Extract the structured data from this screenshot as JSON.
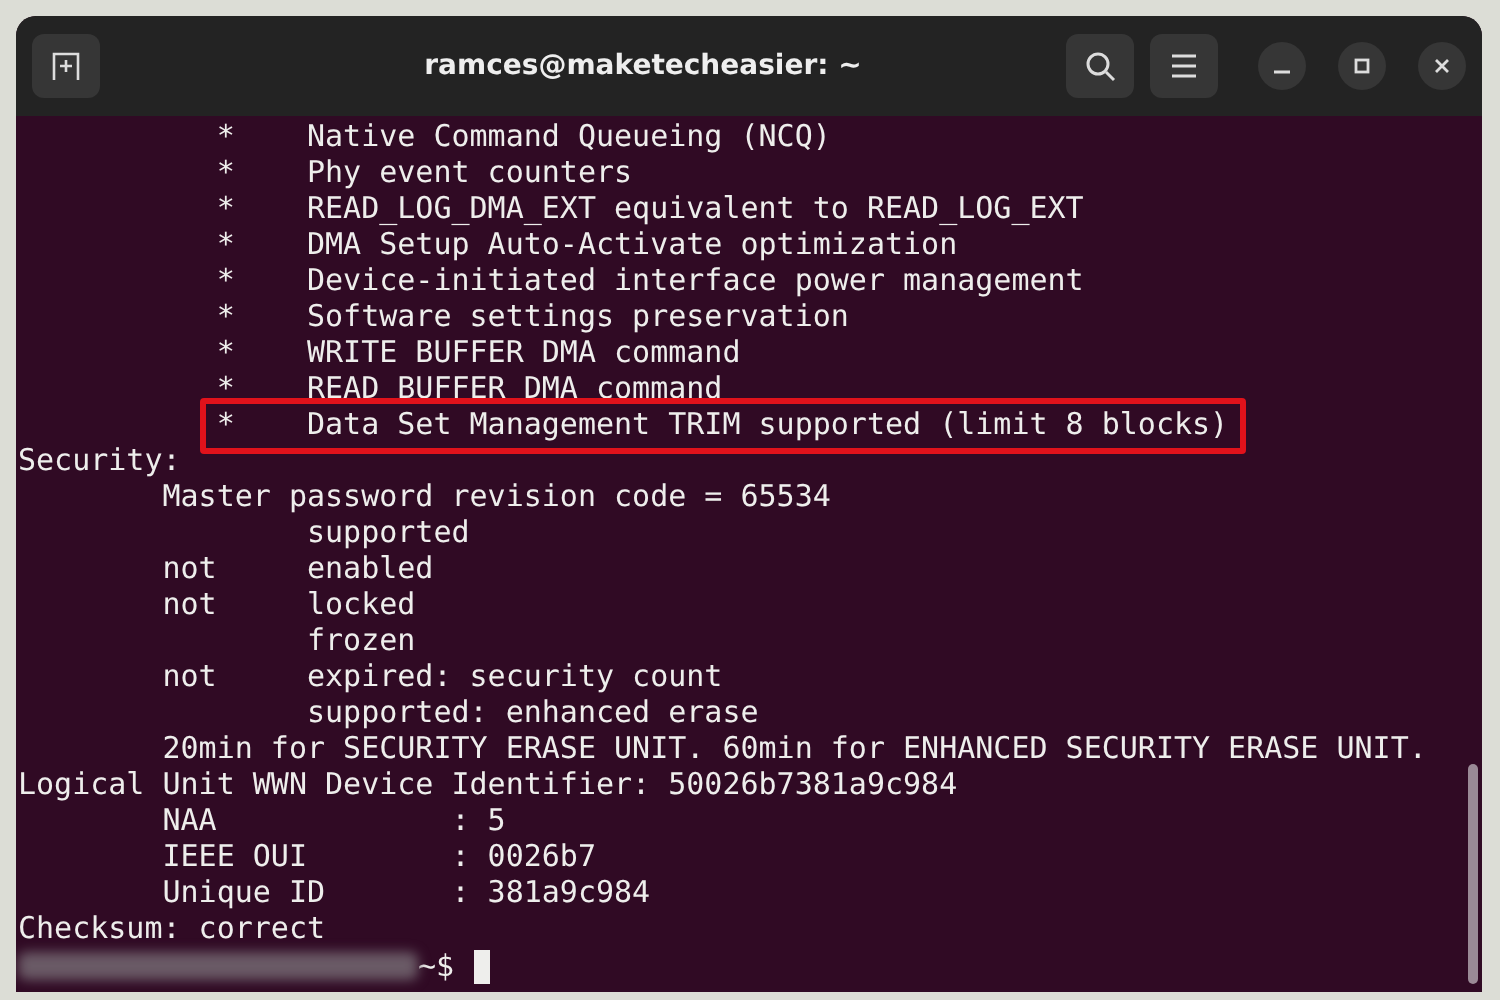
{
  "window": {
    "title": "ramces@maketecheasier: ~"
  },
  "terminal": {
    "lines": [
      {
        "text": "           *    Native Command Queueing (NCQ)",
        "highlighted": false
      },
      {
        "text": "           *    Phy event counters",
        "highlighted": false
      },
      {
        "text": "           *    READ_LOG_DMA_EXT equivalent to READ_LOG_EXT",
        "highlighted": false
      },
      {
        "text": "           *    DMA Setup Auto-Activate optimization",
        "highlighted": false
      },
      {
        "text": "           *    Device-initiated interface power management",
        "highlighted": false
      },
      {
        "text": "           *    Software settings preservation",
        "highlighted": false
      },
      {
        "text": "           *    WRITE BUFFER DMA command",
        "highlighted": false
      },
      {
        "text": "           *    READ BUFFER DMA command",
        "highlighted": false
      },
      {
        "text": "           *    Data Set Management TRIM supported (limit 8 blocks)",
        "highlighted": true
      },
      {
        "text": "Security:",
        "highlighted": false
      },
      {
        "text": "        Master password revision code = 65534",
        "highlighted": false
      },
      {
        "text": "                supported",
        "highlighted": false
      },
      {
        "text": "        not     enabled",
        "highlighted": false
      },
      {
        "text": "        not     locked",
        "highlighted": false
      },
      {
        "text": "                frozen",
        "highlighted": false
      },
      {
        "text": "        not     expired: security count",
        "highlighted": false
      },
      {
        "text": "                supported: enhanced erase",
        "highlighted": false
      },
      {
        "text": "        20min for SECURITY ERASE UNIT. 60min for ENHANCED SECURITY ERASE UNIT.",
        "highlighted": false
      },
      {
        "text": "Logical Unit WWN Device Identifier: 50026b7381a9c984",
        "highlighted": false
      },
      {
        "text": "        NAA             : 5",
        "highlighted": false
      },
      {
        "text": "        IEEE OUI        : 0026b7",
        "highlighted": false
      },
      {
        "text": "        Unique ID       : 381a9c984",
        "highlighted": false
      },
      {
        "text": "Checksum: correct",
        "highlighted": false
      }
    ],
    "prompt": "~$"
  }
}
